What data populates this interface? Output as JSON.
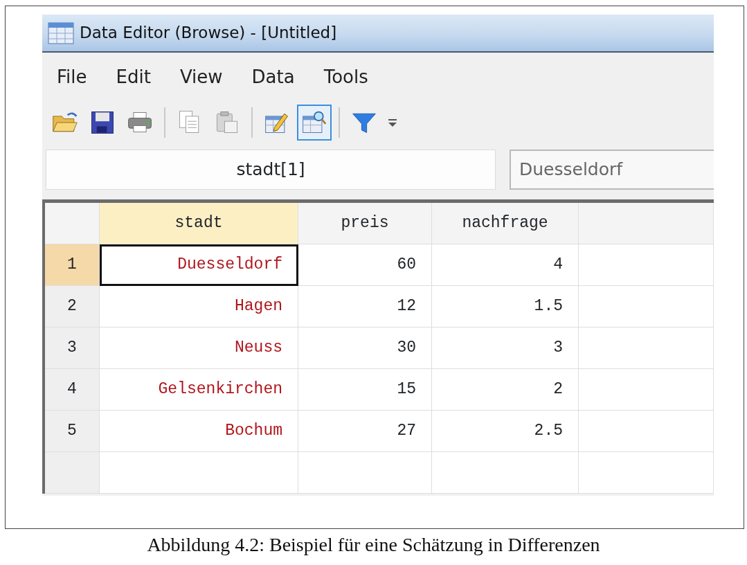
{
  "window": {
    "title": "Data Editor (Browse) - [Untitled]"
  },
  "menu": [
    {
      "label": "File"
    },
    {
      "label": "Edit"
    },
    {
      "label": "View"
    },
    {
      "label": "Data"
    },
    {
      "label": "Tools"
    }
  ],
  "toolbar": [
    {
      "kind": "open",
      "selected": false
    },
    {
      "kind": "save",
      "selected": false
    },
    {
      "kind": "print",
      "selected": false
    },
    {
      "kind": "separator"
    },
    {
      "kind": "copy",
      "selected": false
    },
    {
      "kind": "paste",
      "selected": false
    },
    {
      "kind": "separator"
    },
    {
      "kind": "edit",
      "selected": false
    },
    {
      "kind": "browse",
      "selected": true
    },
    {
      "kind": "separator"
    },
    {
      "kind": "filter",
      "selected": false
    },
    {
      "kind": "overflow",
      "selected": false
    }
  ],
  "cell_reference": "stadt[1]",
  "cell_value": "Duesseldorf",
  "table": {
    "columns": [
      {
        "name": "stadt",
        "selected": true
      },
      {
        "name": "preis",
        "selected": false
      },
      {
        "name": "nachfrage",
        "selected": false
      }
    ],
    "rows": [
      {
        "number": "1",
        "selected": true,
        "cells": [
          {
            "value": "Duesseldorf",
            "kind": "string",
            "selected": true
          },
          {
            "value": "60",
            "kind": "number",
            "selected": false
          },
          {
            "value": "4",
            "kind": "number",
            "selected": false
          }
        ]
      },
      {
        "number": "2",
        "selected": false,
        "cells": [
          {
            "value": "Hagen",
            "kind": "string",
            "selected": false
          },
          {
            "value": "12",
            "kind": "number",
            "selected": false
          },
          {
            "value": "1.5",
            "kind": "number",
            "selected": false
          }
        ]
      },
      {
        "number": "3",
        "selected": false,
        "cells": [
          {
            "value": "Neuss",
            "kind": "string",
            "selected": false
          },
          {
            "value": "30",
            "kind": "number",
            "selected": false
          },
          {
            "value": "3",
            "kind": "number",
            "selected": false
          }
        ]
      },
      {
        "number": "4",
        "selected": false,
        "cells": [
          {
            "value": "Gelsenkirchen",
            "kind": "string",
            "selected": false
          },
          {
            "value": "15",
            "kind": "number",
            "selected": false
          },
          {
            "value": "2",
            "kind": "number",
            "selected": false
          }
        ]
      },
      {
        "number": "5",
        "selected": false,
        "cells": [
          {
            "value": "Bochum",
            "kind": "string",
            "selected": false
          },
          {
            "value": "27",
            "kind": "number",
            "selected": false
          },
          {
            "value": "2.5",
            "kind": "number",
            "selected": false
          }
        ]
      }
    ]
  },
  "caption": "Abbildung 4.2: Beispiel für eine Schätzung in Differenzen"
}
